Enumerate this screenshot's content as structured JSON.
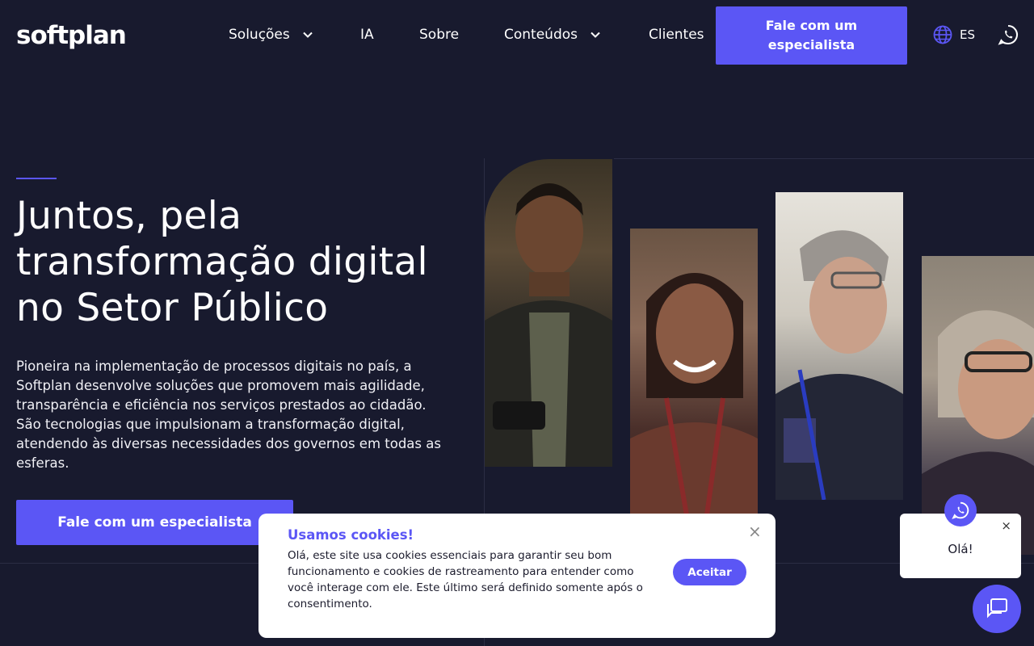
{
  "nav": {
    "logo": "softplan",
    "items": [
      {
        "label": "Soluções"
      },
      {
        "label": "IA"
      },
      {
        "label": "Sobre"
      },
      {
        "label": "Conteúdos"
      },
      {
        "label": "Clientes"
      }
    ],
    "cta": "Fale com um especialista",
    "lang": "ES"
  },
  "hero": {
    "title": "Juntos, pela transformação digital no Setor Público",
    "text": "Pioneira na implementação de processos digitais no país, a Softplan desenvolve soluções que promovem mais agilidade, transparência e eficiência nos serviços prestados ao cidadão. São tecnologias que impulsionam a transformação digital, atendendo às diversas necessidades dos governos em todas as esferas.",
    "cta": "Fale com um especialista"
  },
  "cookie": {
    "title": "Usamos cookies!",
    "text": "Olá, este site usa cookies essenciais para garantir seu bom funcionamento e cookies de rastreamento para entender como você interage com ele. Este último será definido somente após o consentimento.",
    "button": "Aceitar",
    "close": "×"
  },
  "chat": {
    "greeting": "Olá!",
    "close": "×"
  },
  "colors": {
    "background": "#181a2e",
    "accent": "#5b56f5"
  },
  "icons": [
    "chevron-down-icon",
    "globe-icon",
    "whatsapp-icon",
    "close-icon",
    "chat-icon"
  ]
}
